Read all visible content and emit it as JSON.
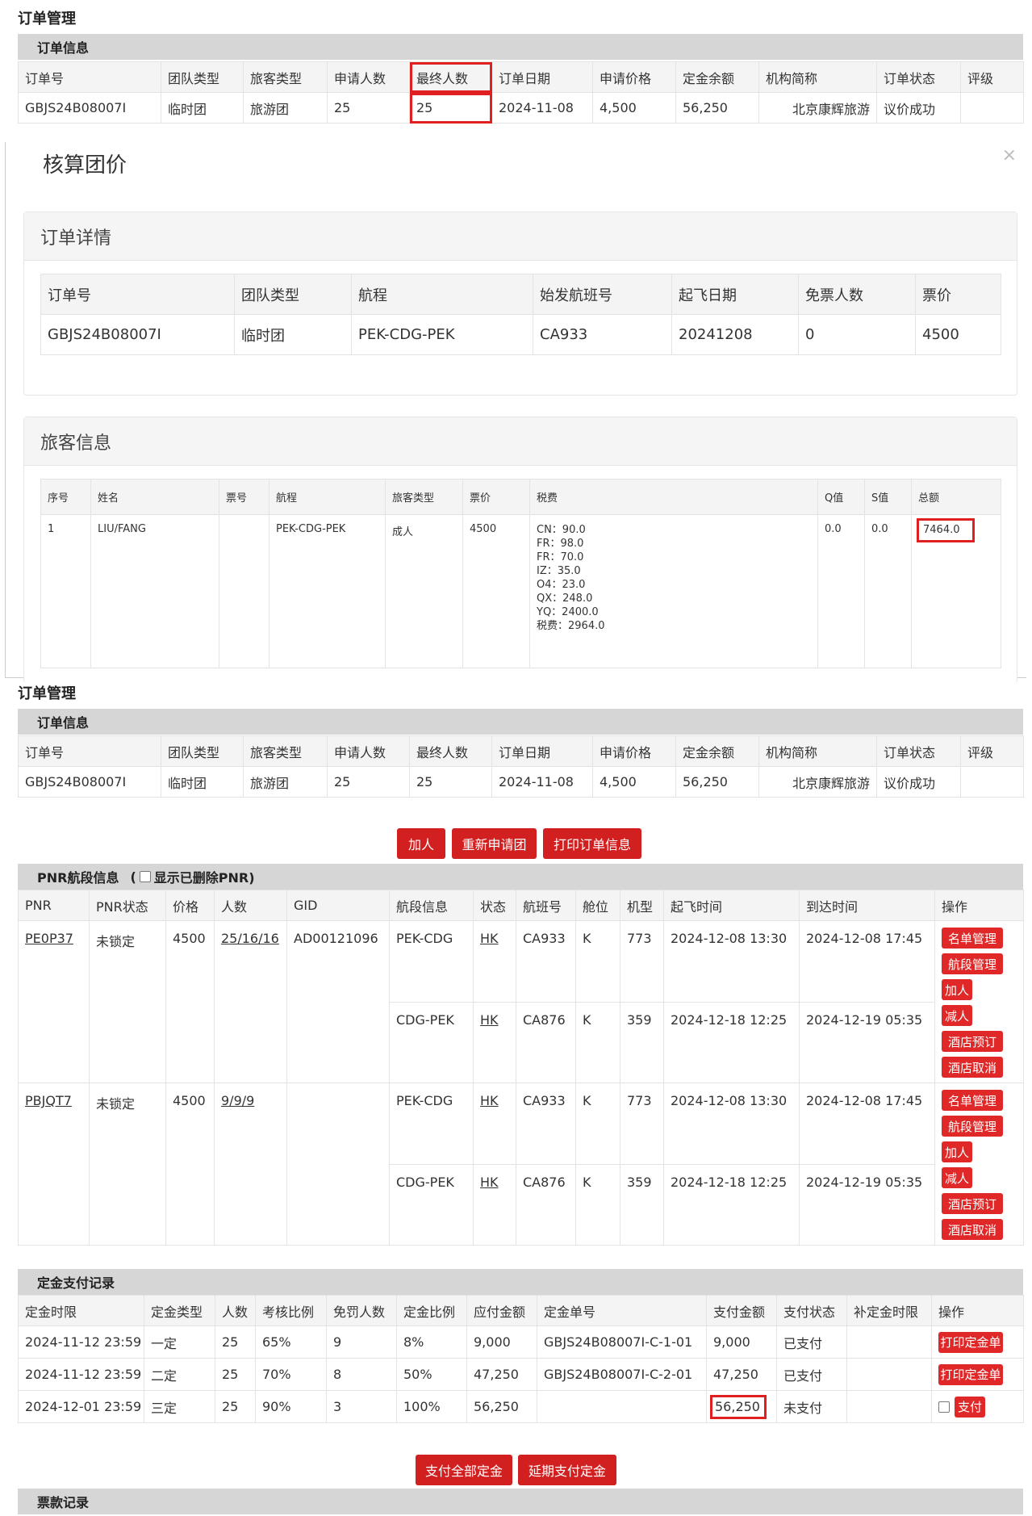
{
  "partA": {
    "title": "订单管理",
    "section": "订单信息",
    "headers": [
      "订单号",
      "团队类型",
      "旅客类型",
      "申请人数",
      "最终人数",
      "订单日期",
      "申请价格",
      "定金余额",
      "机构简称",
      "订单状态",
      "评级"
    ],
    "row": [
      "GBJS24B08007I",
      "临时团",
      "旅游团",
      "25",
      "25",
      "2024-11-08",
      "4,500",
      "56,250",
      "北京康辉旅游",
      "议价成功",
      ""
    ]
  },
  "modal": {
    "title": "核算团价",
    "close": "×",
    "detail": {
      "title": "订单详情",
      "headers": [
        "订单号",
        "团队类型",
        "航程",
        "始发航班号",
        "起飞日期",
        "免票人数",
        "票价"
      ],
      "row": [
        "GBJS24B08007I",
        "临时团",
        "PEK-CDG-PEK",
        "CA933",
        "20241208",
        "0",
        "4500"
      ]
    },
    "pax": {
      "title": "旅客信息",
      "headers": [
        "序号",
        "姓名",
        "票号",
        "航程",
        "旅客类型",
        "票价",
        "税费",
        "Q值",
        "S值",
        "总额"
      ],
      "row": {
        "seq": "1",
        "name": "LIU/FANG",
        "ticket": "",
        "route": "PEK-CDG-PEK",
        "type": "成人",
        "fare": "4500",
        "taxes": [
          "CN：90.0",
          "FR：98.0",
          "FR：70.0",
          "IZ：35.0",
          "O4：23.0",
          "QX：248.0",
          "YQ：2400.0",
          "税费：2964.0"
        ],
        "q": "0.0",
        "s": "0.0",
        "total": "7464.0"
      }
    }
  },
  "partC": {
    "title": "订单管理",
    "section": "订单信息",
    "headers": [
      "订单号",
      "团队类型",
      "旅客类型",
      "申请人数",
      "最终人数",
      "订单日期",
      "申请价格",
      "定金余额",
      "机构简称",
      "订单状态",
      "评级"
    ],
    "row": [
      "GBJS24B08007I",
      "临时团",
      "旅游团",
      "25",
      "25",
      "2024-11-08",
      "4,500",
      "56,250",
      "北京康辉旅游",
      "议价成功",
      ""
    ],
    "buttons": [
      "加人",
      "重新申请团",
      "打印订单信息"
    ],
    "pnr": {
      "title": "PNR航段信息",
      "show_deleted_prefix": "(",
      "show_deleted": "显示已删除PNR)",
      "headers": [
        "PNR",
        "PNR状态",
        "价格",
        "人数",
        "GID",
        "航段信息",
        "状态",
        "航班号",
        "舱位",
        "机型",
        "起飞时间",
        "到达时间",
        "操作"
      ],
      "groups": [
        {
          "pnr": "PE0P37",
          "status": "未锁定",
          "price": "4500",
          "count": "25/16/16",
          "gid": "AD00121096",
          "segments": [
            {
              "seg": "PEK-CDG",
              "st": "HK",
              "flight": "CA933",
              "cabin": "K",
              "type": "773",
              "dep": "2024-12-08 13:30",
              "arr": "2024-12-08 17:45"
            },
            {
              "seg": "CDG-PEK",
              "st": "HK",
              "flight": "CA876",
              "cabin": "K",
              "type": "359",
              "dep": "2024-12-18 12:25",
              "arr": "2024-12-19 05:35"
            }
          ],
          "ops": [
            "名单管理",
            "航段管理",
            "加人",
            "减人",
            "酒店预订",
            "酒店取消"
          ]
        },
        {
          "pnr": "PBJQT7",
          "status": "未锁定",
          "price": "4500",
          "count": "9/9/9",
          "gid": "",
          "segments": [
            {
              "seg": "PEK-CDG",
              "st": "HK",
              "flight": "CA933",
              "cabin": "K",
              "type": "773",
              "dep": "2024-12-08 13:30",
              "arr": "2024-12-08 17:45"
            },
            {
              "seg": "CDG-PEK",
              "st": "HK",
              "flight": "CA876",
              "cabin": "K",
              "type": "359",
              "dep": "2024-12-18 12:25",
              "arr": "2024-12-19 05:35"
            }
          ],
          "ops": [
            "名单管理",
            "航段管理",
            "加人",
            "减人",
            "酒店预订",
            "酒店取消"
          ]
        }
      ]
    },
    "deposit": {
      "title": "定金支付记录",
      "headers": [
        "定金时限",
        "定金类型",
        "人数",
        "考核比例",
        "免罚人数",
        "定金比例",
        "应付金额",
        "定金单号",
        "支付金额",
        "支付状态",
        "补定金时限",
        "操作"
      ],
      "rows": [
        [
          "2024-11-12 23:59",
          "一定",
          "25",
          "65%",
          "9",
          "8%",
          "9,000",
          "GBJS24B08007I-C-1-01",
          "9,000",
          "已支付",
          ""
        ],
        [
          "2024-11-12 23:59",
          "二定",
          "25",
          "70%",
          "8",
          "50%",
          "47,250",
          "GBJS24B08007I-C-2-01",
          "47,250",
          "已支付",
          ""
        ],
        [
          "2024-12-01 23:59",
          "三定",
          "25",
          "90%",
          "3",
          "100%",
          "56,250",
          "",
          "56,250",
          "未支付",
          ""
        ]
      ],
      "print_btn": "打印定金单",
      "pay_btn": "支付",
      "bottom_buttons": [
        "支付全部定金",
        "延期支付定金"
      ]
    },
    "ticket_title": "票款记录"
  }
}
